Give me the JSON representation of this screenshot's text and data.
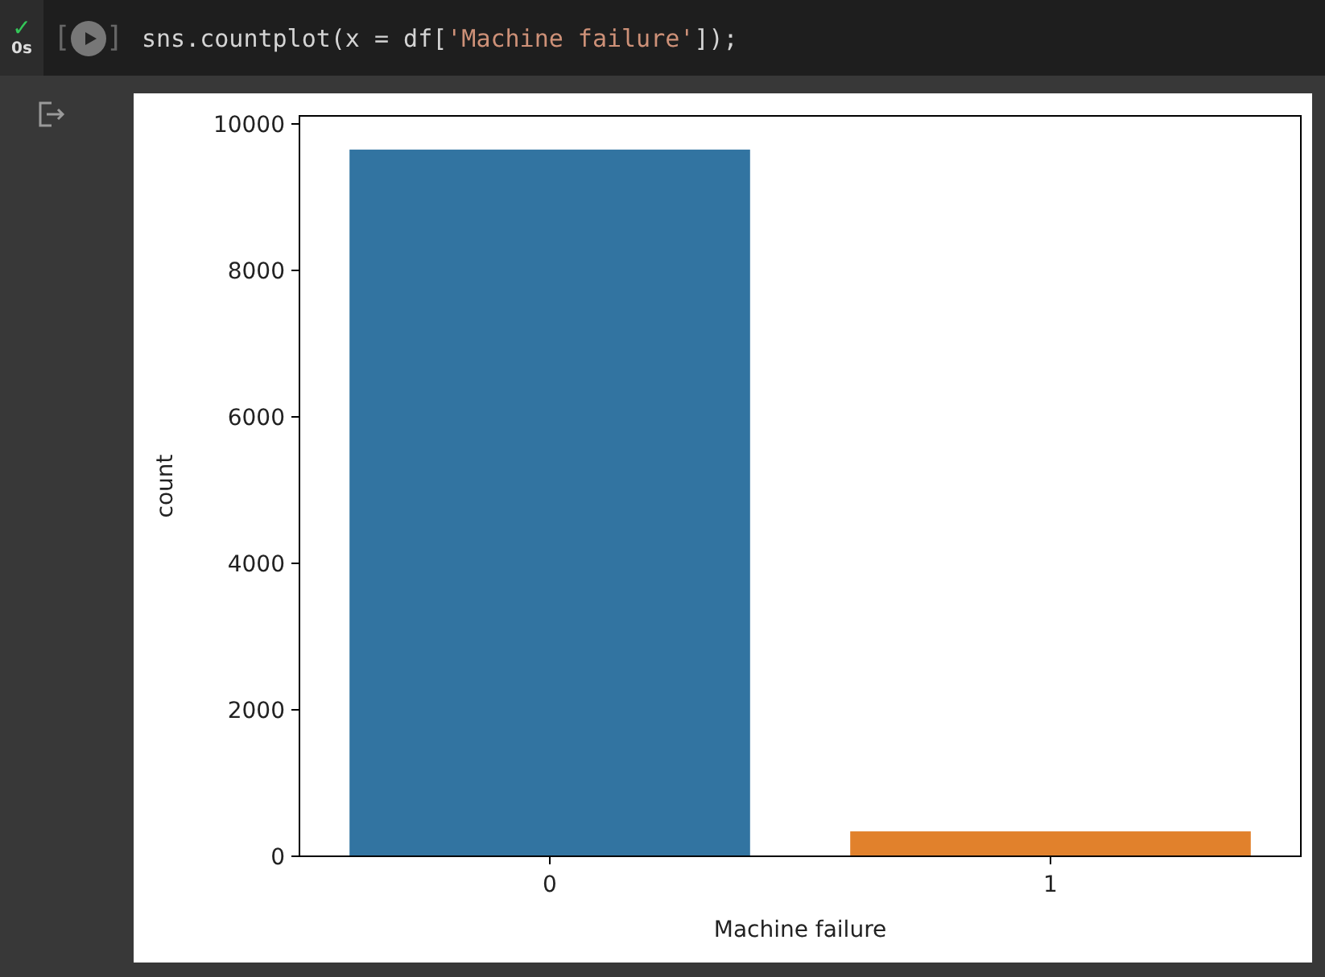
{
  "cell": {
    "status": "✓",
    "duration": "0s",
    "bracket_open": "[",
    "bracket_close": "]",
    "code": [
      {
        "kind": "plain",
        "text": "sns.countplot(x = df["
      },
      {
        "kind": "string",
        "text": "'Machine failure'"
      },
      {
        "kind": "plain",
        "text": "]);"
      }
    ]
  },
  "output": {
    "chart_data": {
      "type": "bar",
      "xlabel": "Machine failure",
      "ylabel": "count",
      "categories": [
        "0",
        "1"
      ],
      "series": [
        {
          "color": "#3274a1",
          "values": [
            9650,
            null
          ]
        },
        {
          "color": "#e1812c",
          "values": [
            null,
            340
          ]
        }
      ],
      "ylim": [
        0,
        10110
      ],
      "yticks": [
        0,
        2000,
        4000,
        6000,
        8000,
        10000
      ]
    }
  }
}
